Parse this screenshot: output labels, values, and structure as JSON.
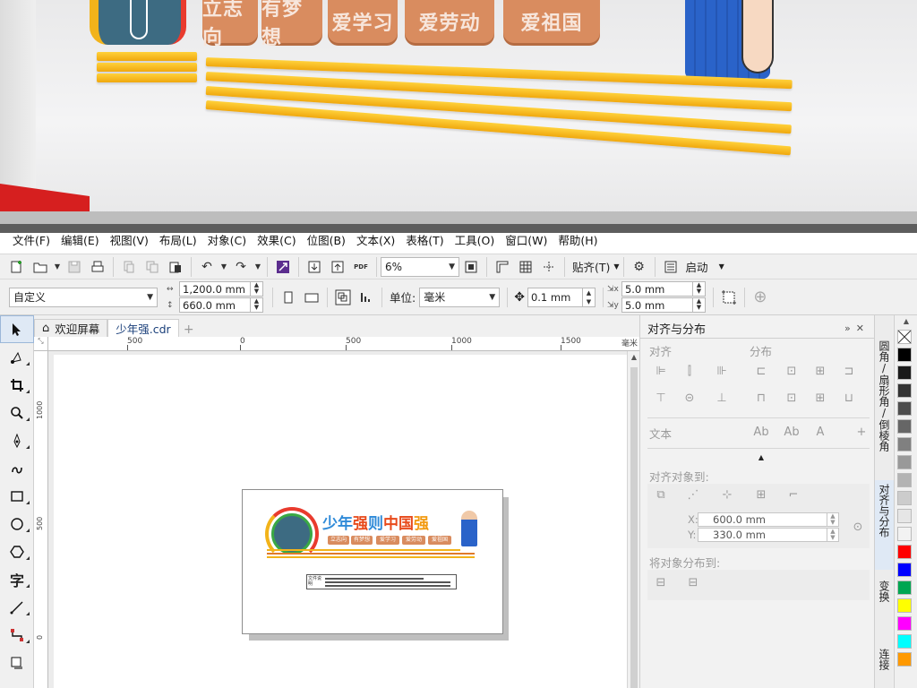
{
  "photo": {
    "tags": [
      "立志向",
      "有梦想",
      "爱学习",
      "爱劳动",
      "爱祖国"
    ]
  },
  "menu": [
    "文件(F)",
    "编辑(E)",
    "视图(V)",
    "布局(L)",
    "对象(C)",
    "效果(C)",
    "位图(B)",
    "文本(X)",
    "表格(T)",
    "工具(O)",
    "窗口(W)",
    "帮助(H)"
  ],
  "toolbar1": {
    "zoom": "6%",
    "snap_label": "贴齐(T)",
    "launch_label": "启动"
  },
  "toolbar2": {
    "page_preset": "自定义",
    "width": "1,200.0 mm",
    "height": "660.0 mm",
    "units_label": "单位:",
    "units_value": "毫米",
    "nudge": "0.1 mm",
    "dup_x": "5.0 mm",
    "dup_y": "5.0 mm"
  },
  "tabs": {
    "welcome": "欢迎屏幕",
    "document": "少年强.cdr"
  },
  "ruler": {
    "h_ticks": [
      "500",
      "0",
      "500",
      "1000",
      "1500"
    ],
    "h_unit": "毫米",
    "v_ticks": [
      "1000",
      "500",
      "0"
    ]
  },
  "doc": {
    "title_parts": [
      "少年",
      "强",
      "则",
      "中国",
      "强"
    ],
    "mini_tags": [
      "立志向",
      "有梦想",
      "爱学习",
      "爱劳动",
      "爱祖国"
    ],
    "label_text": "文件说明"
  },
  "docker": {
    "title": "对齐与分布",
    "align_label": "对齐",
    "distribute_label": "分布",
    "text_label": "文本",
    "align_to_label": "对齐对象到:",
    "x_label": "X:",
    "x_value": "600.0 mm",
    "y_label": "Y:",
    "y_value": "330.0 mm",
    "distribute_to_label": "将对象分布到:"
  },
  "side_tabs": [
    "圆角/扇形角/倒棱角",
    "对齐与分布",
    "变换",
    "连接"
  ],
  "palette": [
    "#ffffff",
    "#000000",
    "#1a1a1a",
    "#333333",
    "#4d4d4d",
    "#666666",
    "#808080",
    "#999999",
    "#b3b3b3",
    "#cccccc",
    "#e6e6e6",
    "#f2f2f2",
    "#ff0000",
    "#0000ff",
    "#00a651",
    "#ffff00",
    "#ff00ff",
    "#00ffff",
    "#ff9900"
  ]
}
